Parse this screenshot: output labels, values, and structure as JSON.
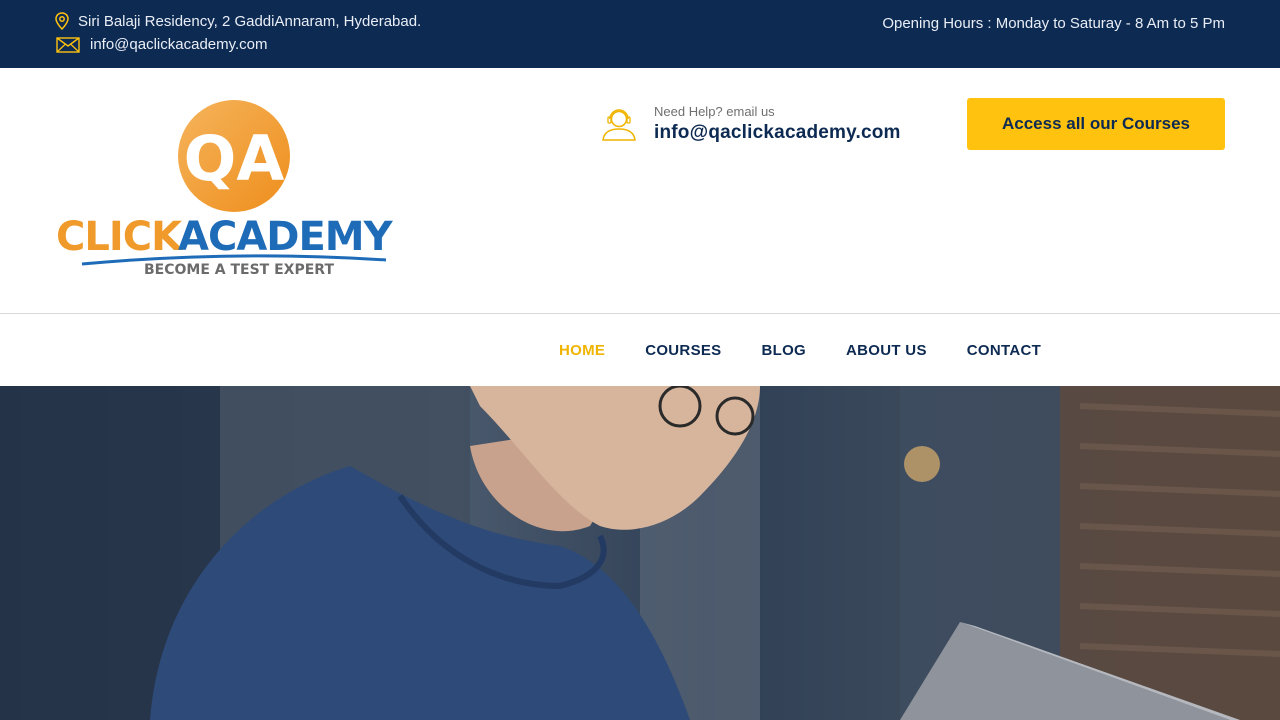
{
  "topbar": {
    "address": "Siri Balaji Residency, 2 GaddiAnnaram, Hyderabad.",
    "email": "info@qaclickacademy.com",
    "hours": "Opening Hours : Monday to Saturay - 8 Am to 5 Pm",
    "address_icon": "location-pin-icon",
    "email_icon": "envelope-icon"
  },
  "logo": {
    "badge_text": "QA",
    "brand_part1": "CLICK",
    "brand_part2": "ACADEMY",
    "tagline": "BECOME A TEST EXPERT"
  },
  "help": {
    "label": "Need Help? email us",
    "email": "info@qaclickacademy.com",
    "icon": "support-agent-icon"
  },
  "cta": {
    "label": "Access all our Courses"
  },
  "nav": {
    "items": [
      {
        "label": "HOME",
        "active": true
      },
      {
        "label": "COURSES",
        "active": false
      },
      {
        "label": "BLOG",
        "active": false
      },
      {
        "label": "ABOUT US",
        "active": false
      },
      {
        "label": "CONTACT",
        "active": false
      }
    ]
  },
  "colors": {
    "navy": "#0d2a52",
    "accent_yellow": "#fec20f",
    "active_nav": "#f0b400",
    "logo_orange": "#f09a2a",
    "logo_blue": "#1e6cb8"
  }
}
